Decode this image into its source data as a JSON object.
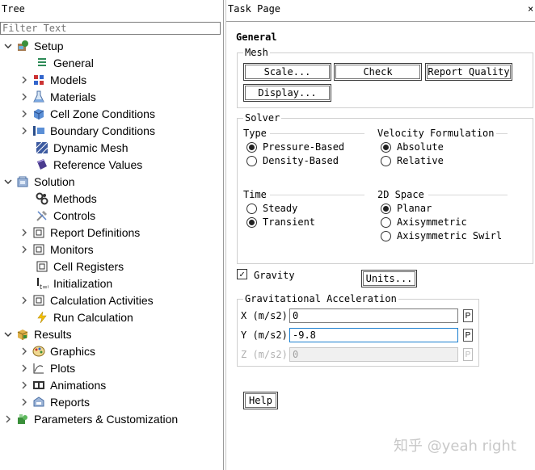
{
  "tree": {
    "title": "Tree",
    "filter_placeholder": "Filter Text",
    "items": [
      {
        "label": "Setup",
        "icon": "setup-icon"
      },
      {
        "label": "General",
        "icon": "general-icon"
      },
      {
        "label": "Models",
        "icon": "models-icon"
      },
      {
        "label": "Materials",
        "icon": "materials-icon"
      },
      {
        "label": "Cell Zone Conditions",
        "icon": "cell-zone-icon"
      },
      {
        "label": "Boundary Conditions",
        "icon": "boundary-icon"
      },
      {
        "label": "Dynamic Mesh",
        "icon": "dynamic-mesh-icon"
      },
      {
        "label": "Reference Values",
        "icon": "reference-values-icon"
      },
      {
        "label": "Solution",
        "icon": "solution-icon"
      },
      {
        "label": "Methods",
        "icon": "methods-icon"
      },
      {
        "label": "Controls",
        "icon": "controls-icon"
      },
      {
        "label": "Report Definitions",
        "icon": "report-definitions-icon"
      },
      {
        "label": "Monitors",
        "icon": "monitors-icon"
      },
      {
        "label": "Cell Registers",
        "icon": "cell-registers-icon"
      },
      {
        "label": "Initialization",
        "icon": "initialization-icon"
      },
      {
        "label": "Calculation Activities",
        "icon": "calculation-activities-icon"
      },
      {
        "label": "Run Calculation",
        "icon": "run-calculation-icon"
      },
      {
        "label": "Results",
        "icon": "results-icon"
      },
      {
        "label": "Graphics",
        "icon": "graphics-icon"
      },
      {
        "label": "Plots",
        "icon": "plots-icon"
      },
      {
        "label": "Animations",
        "icon": "animations-icon"
      },
      {
        "label": "Reports",
        "icon": "reports-icon"
      },
      {
        "label": "Parameters & Customization",
        "icon": "parameters-icon"
      }
    ]
  },
  "task": {
    "title": "Task Page",
    "close": "×",
    "page": "General",
    "mesh": {
      "legend": "Mesh",
      "scale": "Scale...",
      "check": "Check",
      "report_quality": "Report Quality",
      "display": "Display..."
    },
    "solver": {
      "legend": "Solver",
      "type_label": "Type",
      "type_options": [
        "Pressure-Based",
        "Density-Based"
      ],
      "type_selected": "Pressure-Based",
      "velocity_label": "Velocity Formulation",
      "velocity_options": [
        "Absolute",
        "Relative"
      ],
      "velocity_selected": "Absolute",
      "time_label": "Time",
      "time_options": [
        "Steady",
        "Transient"
      ],
      "time_selected": "Transient",
      "space_label": "2D Space",
      "space_options": [
        "Planar",
        "Axisymmetric",
        "Axisymmetric Swirl"
      ],
      "space_selected": "Planar"
    },
    "gravity": {
      "label": "Gravity",
      "checked": true,
      "check_mark": "✓",
      "units": "Units..."
    },
    "grav_accel": {
      "legend": "Gravitational Acceleration",
      "x_label": "X (m/s2)",
      "x_value": "0",
      "y_label": "Y (m/s2)",
      "y_value": "-9.8",
      "z_label": "Z (m/s2)",
      "z_value": "0",
      "param_label": "P"
    },
    "help": "Help"
  },
  "watermark": "知乎 @yeah right"
}
